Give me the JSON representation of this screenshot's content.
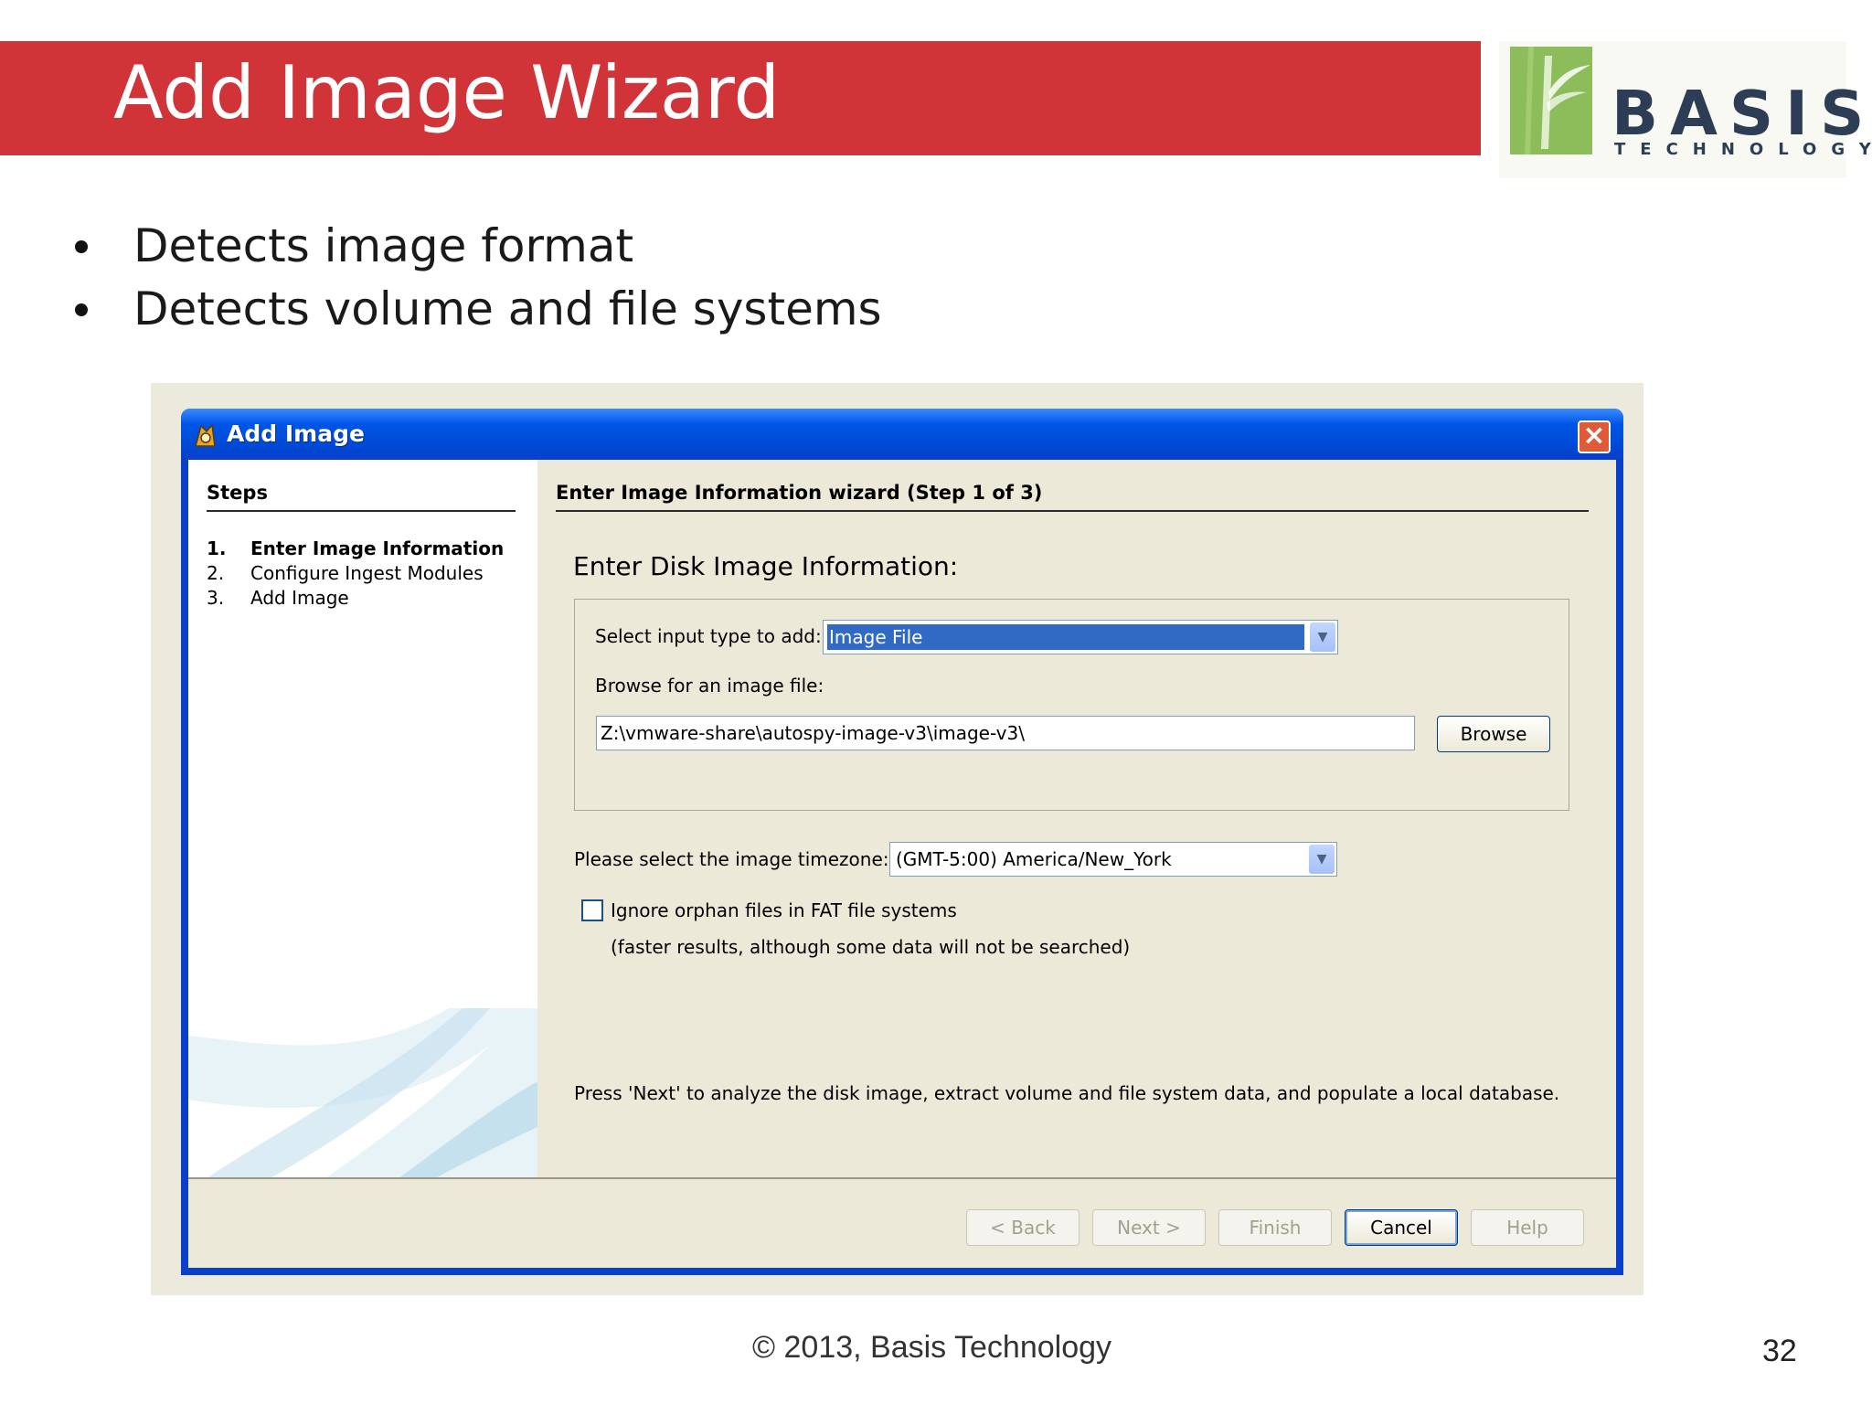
{
  "slide": {
    "title": "Add Image Wizard",
    "bullets": [
      "Detects image format",
      "Detects volume and file systems"
    ],
    "footer": "© 2013, Basis Technology",
    "page_number": "32",
    "logo": {
      "name": "BASIS",
      "sub": "TECHNOLOGY"
    }
  },
  "window": {
    "title": "Add Image",
    "steps_header": "Steps",
    "steps": [
      {
        "num": "1.",
        "label": "Enter Image Information"
      },
      {
        "num": "2.",
        "label": "Configure Ingest Modules"
      },
      {
        "num": "3.",
        "label": "Add Image"
      }
    ],
    "active_step": 1,
    "wizard_title": "Enter Image Information wizard (Step 1 of 3)",
    "section_title": "Enter Disk Image Information:",
    "input_type_label": "Select input type to add:",
    "input_type_value": "Image File",
    "browse_label": "Browse for an image file:",
    "image_path": "Z:\\vmware-share\\autospy-image-v3\\image-v3\\",
    "browse_button": "Browse",
    "timezone_label": "Please select the image timezone:",
    "timezone_value": "(GMT-5:00) America/New_York",
    "orphan_checkbox_label": "Ignore orphan files in FAT file systems",
    "orphan_checkbox_checked": false,
    "orphan_note": "(faster results, although some data will not be searched)",
    "instruction": "Press 'Next' to analyze the disk image, extract volume and file system data, and populate a local database.",
    "buttons": {
      "back": "< Back",
      "next": "Next >",
      "finish": "Finish",
      "cancel": "Cancel",
      "help": "Help"
    }
  },
  "colors": {
    "title_bar": "#d13438",
    "xp_titlebar": "#0055e6",
    "dialog_bg": "#ece9d8",
    "selection": "#316ac5"
  }
}
